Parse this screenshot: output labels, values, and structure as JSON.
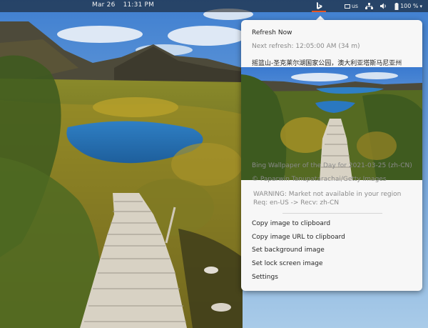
{
  "topbar": {
    "date": "Mar 26",
    "time": "11:31 PM",
    "keyboard_layout": "us",
    "battery": "100 %"
  },
  "menu": {
    "refresh_now": "Refresh Now",
    "next_refresh": "Next refresh: 12:05:00 AM (34 m)",
    "image_title": "摇篮山-圣克莱尔湖国家公园，澳大利亚塔斯马尼亚州",
    "caption": "Bing Wallpaper of the Day for 2021-03-25 (zh-CN)",
    "copyright": "© Paparwin Tanupatarachai/Getty Images",
    "warning_line1": "WARNING: Market not available in your region",
    "warning_line2": "Req: en-US -> Recv: zh-CN",
    "actions": [
      "Copy image to clipboard",
      "Copy image URL to clipboard",
      "Set background image",
      "Set lock screen image",
      "Settings"
    ]
  },
  "icons": {
    "bing": "bing-icon",
    "keyboard": "keyboard-icon",
    "network": "network-icon",
    "volume": "volume-icon",
    "battery": "battery-icon"
  },
  "colors": {
    "menu_bg": "#f7f7f7",
    "accent": "#e95420",
    "topbar_bg": "#121212"
  }
}
